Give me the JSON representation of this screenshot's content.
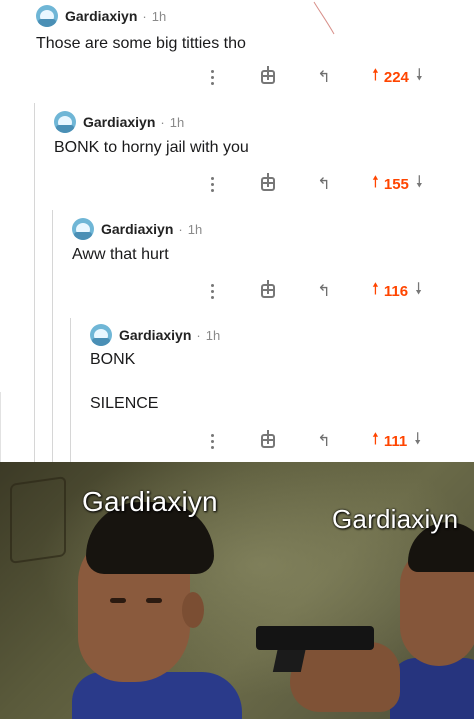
{
  "comments": [
    {
      "username": "Gardiaxiyn",
      "separator": "·",
      "time": "1h",
      "body": [
        "Those are some big titties tho"
      ],
      "score": "224"
    },
    {
      "username": "Gardiaxiyn",
      "separator": "·",
      "time": "1h",
      "body": [
        "BONK to horny jail with you"
      ],
      "score": "155"
    },
    {
      "username": "Gardiaxiyn",
      "separator": "·",
      "time": "1h",
      "body": [
        "Aww that hurt"
      ],
      "score": "116"
    },
    {
      "username": "Gardiaxiyn",
      "separator": "·",
      "time": "1h",
      "body": [
        "BONK",
        "SILENCE"
      ],
      "score": "111"
    }
  ],
  "icons": {
    "more": "kebab-icon",
    "award": "award-icon",
    "reply": "reply-icon",
    "upvote": "upvote-arrow-icon",
    "downvote": "downvote-arrow-icon"
  },
  "colors": {
    "upvote": "#ff4500",
    "icon_gray": "#7b7b7b",
    "thread_line": "#d6d6d6"
  },
  "meme": {
    "caption_left": "Gardiaxiyn",
    "caption_right": "Gardiaxiyn"
  }
}
